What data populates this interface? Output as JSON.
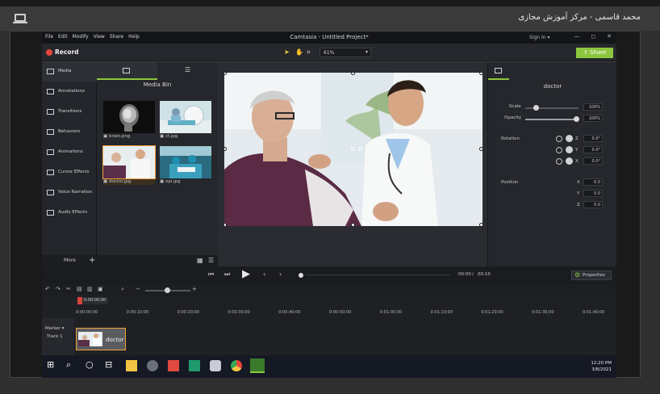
{
  "window": {
    "title": "محمد قاسمی - مرکز آموزش مجازی"
  },
  "menubar": {
    "items": [
      "File",
      "Edit",
      "Modify",
      "View",
      "Share",
      "Help"
    ],
    "app_title": "Camtasia - Untitled Project*",
    "signin": "Sign In ▾",
    "win_min": "—",
    "win_max": "◻",
    "win_close": "✕"
  },
  "toolbar": {
    "record_label": "Record",
    "zoom_value": "61%",
    "share_label": "Share",
    "accent": "#8cc63f",
    "record_color": "#e8453c"
  },
  "sidebar": {
    "items": [
      {
        "label": "Media",
        "icon": "film-icon"
      },
      {
        "label": "Annotations",
        "icon": "annotation-icon"
      },
      {
        "label": "Transitions",
        "icon": "transition-icon"
      },
      {
        "label": "Behaviors",
        "icon": "behavior-icon"
      },
      {
        "label": "Animations",
        "icon": "animation-icon"
      },
      {
        "label": "Cursor Effects",
        "icon": "cursor-icon"
      },
      {
        "label": "Voice Narration",
        "icon": "microphone-icon"
      },
      {
        "label": "Audio Effects",
        "icon": "speaker-icon"
      }
    ],
    "more_label": "More",
    "add_label": "+"
  },
  "media_bin": {
    "title": "Media Bin",
    "items": [
      {
        "name": "brain.png"
      },
      {
        "name": "ct.jpg"
      },
      {
        "name": "doctor.jpg"
      },
      {
        "name": "opi.jpg"
      }
    ]
  },
  "properties": {
    "title": "doctor",
    "scale_label": "Scale",
    "scale_value": "100%",
    "opacity_label": "Opacity",
    "opacity_value": "100%",
    "rotation_label": "Rotation",
    "rotation": {
      "z": "0.0°",
      "y": "0.0°",
      "x": "0.0°"
    },
    "position_label": "Position",
    "position": {
      "x": "0.0",
      "y": "0.0",
      "z": "0.0"
    },
    "axis_x": "X",
    "axis_y": "Y",
    "axis_z": "Z",
    "button_label": "Properties"
  },
  "playback": {
    "current": "00:00",
    "separator": "/",
    "duration": "00:10"
  },
  "timeline": {
    "playhead_time": "0:00:00;00",
    "ticks": [
      "0:00:00;00",
      "0:00:10;00",
      "0:00:20;00",
      "0:00:30;00",
      "0:00:40;00",
      "0:00:50;00",
      "0:01:00;00",
      "0:01:10;00",
      "0:01:20;00",
      "0:01:30;00",
      "0:01:40;00"
    ],
    "marker_label": "Marker",
    "track_label": "Track 1",
    "clip_label": "doctor"
  },
  "taskbar": {
    "time": "12:20 PM",
    "date": "3/8/2021"
  }
}
